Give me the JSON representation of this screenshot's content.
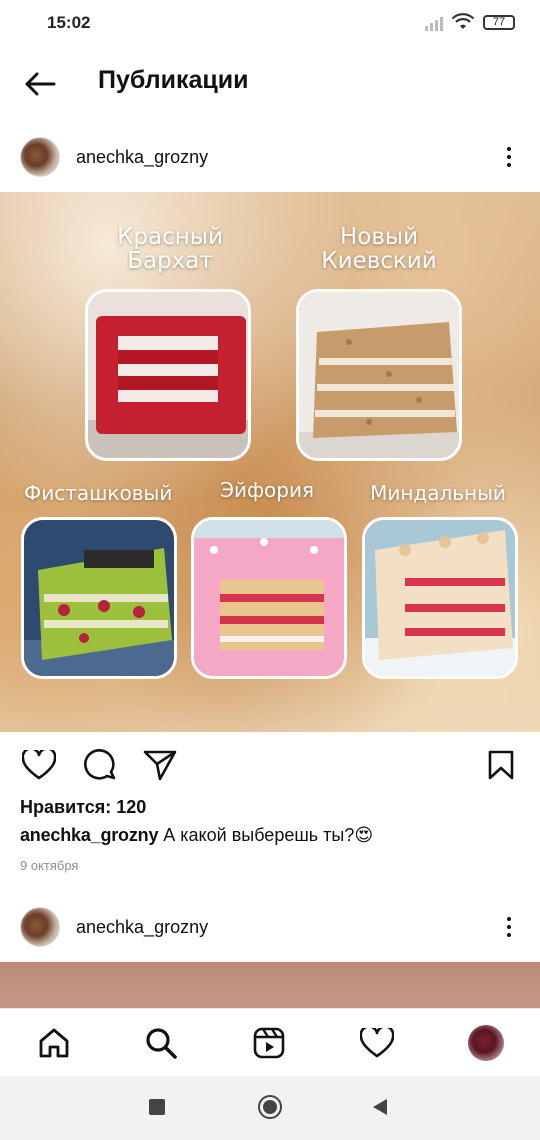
{
  "status_bar": {
    "time": "15:02",
    "battery": "77"
  },
  "header": {
    "title": "Публикации"
  },
  "post": {
    "username": "anechka_grozny",
    "image_labels": {
      "red_velvet": "Красный\nБархат",
      "kievsky": "Новый\nКиевский",
      "pistachio": "Фисташковый",
      "euphoria": "Эйфория",
      "almond": "Миндальный"
    },
    "likes": "Нравится: 120",
    "caption_user": "anechka_grozny",
    "caption_text": " А какой выберешь ты?😍",
    "date": "9 октября"
  },
  "post2": {
    "username": "anechka_grozny"
  },
  "bottom_nav": [
    "home-icon",
    "search-icon",
    "reels-icon",
    "heart-icon",
    "profile-avatar"
  ],
  "system_nav": [
    "recents-square",
    "home-circle",
    "back-triangle"
  ],
  "colors": {
    "text": "#111111",
    "muted": "#8e8e8e",
    "sys_nav_bg": "#f2f2f2"
  }
}
